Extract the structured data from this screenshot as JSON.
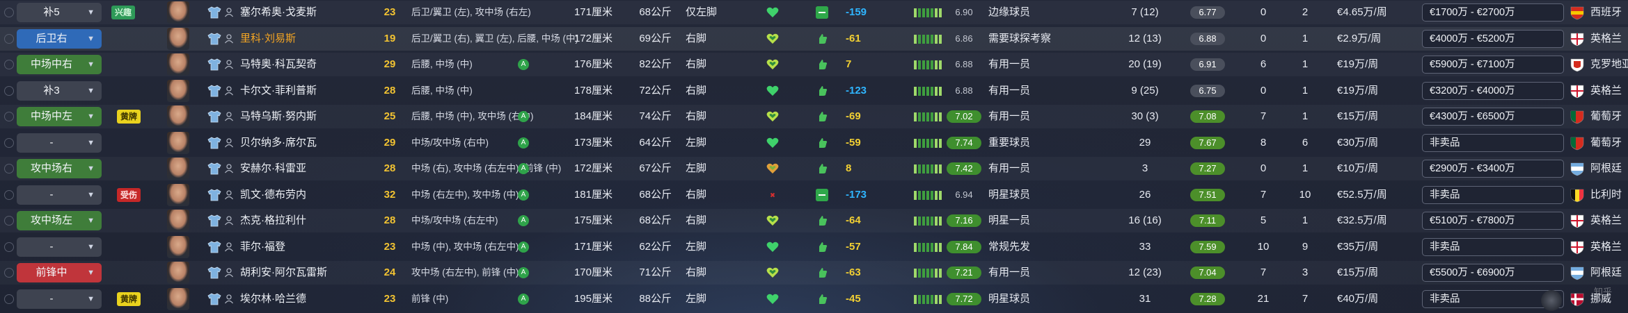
{
  "watermark": "知乎",
  "colors": {
    "accent_green": "#7ad63a",
    "age_yellow": "#f2c332"
  },
  "rows": [
    {
      "position": "补5",
      "pos_color": "#3e4350",
      "tag": "兴趣",
      "tag_bg": "#2e9a58",
      "tag_fg": "#cdf3d6",
      "name": "塞尔希奥·戈麦斯",
      "name_color": "#eef1f6",
      "age": "23",
      "positions": "后卫/翼卫 (左), 攻中场 (右左)",
      "condition": "",
      "height": "171厘米",
      "weight": "68公斤",
      "foot": "仅左脚",
      "heart": "green-heart-icon",
      "morale": "neutral",
      "fitness": "-159",
      "fit_color": "#2fb5ff",
      "bars": "lgggg",
      "rating": "6.90",
      "rating_bg": "",
      "status": "边缘球员",
      "apps": "7 (12)",
      "avg": "6.77",
      "avg_bg": "#4a4f5c",
      "goals": "0",
      "assists": "2",
      "wage": "€4.65万/周",
      "value": "€1700万 - €2700万",
      "flag": "spain-flag-icon",
      "nation": "西班牙"
    },
    {
      "position": "后卫右",
      "pos_color": "#2f6ab8",
      "tag": "",
      "tag_bg": "",
      "tag_fg": "",
      "name": "里科·刘易斯",
      "name_color": "#f5a623",
      "age": "19",
      "positions": "后卫/翼卫 (右), 翼卫 (左), 后腰, 中场 (中)",
      "condition": "",
      "height": "172厘米",
      "weight": "69公斤",
      "foot": "右脚",
      "heart": "double-heart-icon",
      "morale": "good",
      "fitness": "-61",
      "fit_color": "#f2d033",
      "bars": "lgggg",
      "rating": "6.86",
      "rating_bg": "",
      "status": "需要球探考察",
      "apps": "12 (13)",
      "avg": "6.88",
      "avg_bg": "#4a4f5c",
      "goals": "0",
      "assists": "1",
      "wage": "€2.9万/周",
      "value": "€4000万 - €5200万",
      "flag": "england-flag-icon",
      "nation": "英格兰"
    },
    {
      "position": "中场中右",
      "pos_color": "#3f7d3a",
      "tag": "",
      "tag_bg": "",
      "tag_fg": "",
      "name": "马特奥·科瓦契奇",
      "name_color": "#eef1f6",
      "age": "29",
      "positions": "后腰, 中场 (中)",
      "condition": "A",
      "height": "176厘米",
      "weight": "82公斤",
      "foot": "右脚",
      "heart": "double-heart-icon",
      "morale": "good",
      "fitness": "7",
      "fit_color": "#f2d033",
      "bars": "lgggg",
      "rating": "6.88",
      "rating_bg": "",
      "status": "有用一员",
      "apps": "20 (19)",
      "avg": "6.91",
      "avg_bg": "#4a4f5c",
      "goals": "6",
      "assists": "1",
      "wage": "€19万/周",
      "value": "€5900万 - €7100万",
      "flag": "croatia-flag-icon",
      "nation": "克罗地亚"
    },
    {
      "position": "补3",
      "pos_color": "#3e4350",
      "tag": "",
      "tag_bg": "",
      "tag_fg": "",
      "name": "卡尔文·菲利普斯",
      "name_color": "#eef1f6",
      "age": "28",
      "positions": "后腰, 中场 (中)",
      "condition": "",
      "height": "178厘米",
      "weight": "72公斤",
      "foot": "右脚",
      "heart": "green-heart-icon",
      "morale": "good",
      "fitness": "-123",
      "fit_color": "#2fb5ff",
      "bars": "lgggg",
      "rating": "6.88",
      "rating_bg": "",
      "status": "有用一员",
      "apps": "9 (25)",
      "avg": "6.75",
      "avg_bg": "#4a4f5c",
      "goals": "0",
      "assists": "1",
      "wage": "€19万/周",
      "value": "€3200万 - €4000万",
      "flag": "england-flag-icon",
      "nation": "英格兰"
    },
    {
      "position": "中场中左",
      "pos_color": "#3f7d3a",
      "tag": "黄牌",
      "tag_bg": "#e9d21e",
      "tag_fg": "#3a3200",
      "name": "马特乌斯·努内斯",
      "name_color": "#eef1f6",
      "age": "25",
      "positions": "后腰, 中场 (中), 攻中场 (右中)",
      "condition": "A",
      "height": "184厘米",
      "weight": "74公斤",
      "foot": "右脚",
      "heart": "double-heart-icon",
      "morale": "good",
      "fitness": "-69",
      "fit_color": "#f2d033",
      "bars": "lgggg",
      "rating": "7.02",
      "rating_bg": "#3f8f2e",
      "status": "有用一员",
      "apps": "30 (3)",
      "avg": "7.08",
      "avg_bg": "#4c8f2a",
      "goals": "7",
      "assists": "1",
      "wage": "€15万/周",
      "value": "€4300万 - €6500万",
      "flag": "portugal-flag-icon",
      "nation": "葡萄牙"
    },
    {
      "position": "-",
      "pos_color": "#3e4350",
      "tag": "",
      "tag_bg": "",
      "tag_fg": "",
      "name": "贝尔纳多·席尔瓦",
      "name_color": "#eef1f6",
      "age": "29",
      "positions": "中场/攻中场 (右中)",
      "condition": "A",
      "height": "173厘米",
      "weight": "64公斤",
      "foot": "左脚",
      "heart": "green-heart-icon",
      "morale": "good",
      "fitness": "-59",
      "fit_color": "#f2d033",
      "bars": "lgggg",
      "rating": "7.74",
      "rating_bg": "#3f8f2e",
      "status": "重要球员",
      "apps": "29",
      "avg": "7.67",
      "avg_bg": "#4c8f2a",
      "goals": "8",
      "assists": "6",
      "wage": "€30万/周",
      "value": "非卖品",
      "flag": "portugal-flag-icon",
      "nation": "葡萄牙"
    },
    {
      "position": "攻中场右",
      "pos_color": "#3f7d3a",
      "tag": "",
      "tag_bg": "",
      "tag_fg": "",
      "name": "安赫尔·科雷亚",
      "name_color": "#eef1f6",
      "age": "28",
      "positions": "中场 (右), 攻中场 (右左中), 前锋 (中)",
      "condition": "A",
      "height": "172厘米",
      "weight": "67公斤",
      "foot": "左脚",
      "heart": "orange-heart-icon",
      "morale": "good",
      "fitness": "8",
      "fit_color": "#f2d033",
      "bars": "lgggg",
      "rating": "7.42",
      "rating_bg": "#3f8f2e",
      "status": "有用一员",
      "apps": "3",
      "avg": "7.27",
      "avg_bg": "#4c8f2a",
      "goals": "0",
      "assists": "1",
      "wage": "€10万/周",
      "value": "€2900万 - €3400万",
      "flag": "argentina-flag-icon",
      "nation": "阿根廷"
    },
    {
      "position": "-",
      "pos_color": "#3e4350",
      "tag": "受伤",
      "tag_bg": "#c62828",
      "tag_fg": "#ffe3e3",
      "name": "凯文·德布劳内",
      "name_color": "#eef1f6",
      "age": "32",
      "positions": "中场 (右左中), 攻中场 (中)",
      "condition": "A",
      "height": "181厘米",
      "weight": "68公斤",
      "foot": "右脚",
      "heart": "red-cross-icon",
      "morale": "neutral",
      "fitness": "-173",
      "fit_color": "#2fb5ff",
      "bars": "lgggg",
      "rating": "6.94",
      "rating_bg": "",
      "status": "明星球员",
      "apps": "26",
      "avg": "7.51",
      "avg_bg": "#4c8f2a",
      "goals": "7",
      "assists": "10",
      "wage": "€52.5万/周",
      "value": "非卖品",
      "flag": "belgium-flag-icon",
      "nation": "比利时"
    },
    {
      "position": "攻中场左",
      "pos_color": "#3f7d3a",
      "tag": "",
      "tag_bg": "",
      "tag_fg": "",
      "name": "杰克·格拉利什",
      "name_color": "#eef1f6",
      "age": "28",
      "positions": "中场/攻中场 (右左中)",
      "condition": "A",
      "height": "175厘米",
      "weight": "68公斤",
      "foot": "右脚",
      "heart": "double-heart-icon",
      "morale": "good",
      "fitness": "-64",
      "fit_color": "#f2d033",
      "bars": "lgggg",
      "rating": "7.16",
      "rating_bg": "#3f8f2e",
      "status": "明星一员",
      "apps": "16 (16)",
      "avg": "7.11",
      "avg_bg": "#4c8f2a",
      "goals": "5",
      "assists": "1",
      "wage": "€32.5万/周",
      "value": "€5100万 - €7800万",
      "flag": "england-flag-icon",
      "nation": "英格兰"
    },
    {
      "position": "-",
      "pos_color": "#3e4350",
      "tag": "",
      "tag_bg": "",
      "tag_fg": "",
      "name": "菲尔·福登",
      "name_color": "#eef1f6",
      "age": "23",
      "positions": "中场 (中), 攻中场 (右左中)",
      "condition": "A",
      "height": "171厘米",
      "weight": "62公斤",
      "foot": "左脚",
      "heart": "green-heart-icon",
      "morale": "good",
      "fitness": "-57",
      "fit_color": "#f2d033",
      "bars": "lgggg",
      "rating": "7.84",
      "rating_bg": "#3f8f2e",
      "status": "常规先发",
      "apps": "33",
      "avg": "7.59",
      "avg_bg": "#4c8f2a",
      "goals": "10",
      "assists": "9",
      "wage": "€35万/周",
      "value": "非卖品",
      "flag": "england-flag-icon",
      "nation": "英格兰"
    },
    {
      "position": "前锋中",
      "pos_color": "#c0353b",
      "tag": "",
      "tag_bg": "",
      "tag_fg": "",
      "name": "胡利安·阿尔瓦雷斯",
      "name_color": "#eef1f6",
      "age": "24",
      "positions": "攻中场 (右左中), 前锋 (中)",
      "condition": "A",
      "height": "170厘米",
      "weight": "71公斤",
      "foot": "右脚",
      "heart": "double-heart-icon",
      "morale": "good",
      "fitness": "-63",
      "fit_color": "#f2d033",
      "bars": "lgggg",
      "rating": "7.21",
      "rating_bg": "#3f8f2e",
      "status": "有用一员",
      "apps": "12 (23)",
      "avg": "7.04",
      "avg_bg": "#4c8f2a",
      "goals": "7",
      "assists": "3",
      "wage": "€15万/周",
      "value": "€5500万 - €6900万",
      "flag": "argentina-flag-icon",
      "nation": "阿根廷"
    },
    {
      "position": "-",
      "pos_color": "#3e4350",
      "tag": "黄牌",
      "tag_bg": "#e9d21e",
      "tag_fg": "#3a3200",
      "name": "埃尔林·哈兰德",
      "name_color": "#eef1f6",
      "age": "23",
      "positions": "前锋 (中)",
      "condition": "A",
      "height": "195厘米",
      "weight": "88公斤",
      "foot": "左脚",
      "heart": "green-heart-icon",
      "morale": "good",
      "fitness": "-45",
      "fit_color": "#f2d033",
      "bars": "lgggg",
      "rating": "7.72",
      "rating_bg": "#3f8f2e",
      "status": "明星球员",
      "apps": "31",
      "avg": "7.28",
      "avg_bg": "#4c8f2a",
      "goals": "21",
      "assists": "7",
      "wage": "€40万/周",
      "value": "非卖品",
      "flag": "norway-flag-icon",
      "nation": "挪威"
    }
  ]
}
